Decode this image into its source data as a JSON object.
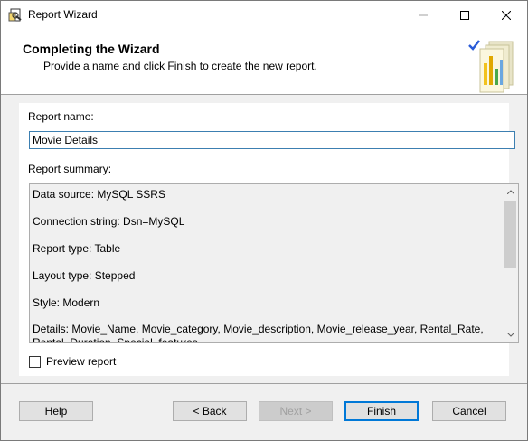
{
  "window": {
    "title": "Report Wizard"
  },
  "header": {
    "title": "Completing the Wizard",
    "subtitle": "Provide a name and click Finish to create the new report."
  },
  "form": {
    "report_name_label": "Report name:",
    "report_name_value": "Movie Details",
    "summary_label": "Report summary:",
    "summary_lines": [
      "Data source: MySQL SSRS",
      "Connection string: Dsn=MySQL",
      "Report type: Table",
      "Layout type: Stepped",
      "Style: Modern",
      "Details: Movie_Name, Movie_category, Movie_description, Movie_release_year, Rental_Rate, Rental_Duration, Special_features"
    ],
    "preview_label": "Preview report",
    "preview_checked": false
  },
  "buttons": {
    "help": "Help",
    "back": "< Back",
    "next": "Next >",
    "finish": "Finish",
    "cancel": "Cancel"
  },
  "colors": {
    "accent": "#0078d7",
    "input_border": "#3c7fb1"
  }
}
